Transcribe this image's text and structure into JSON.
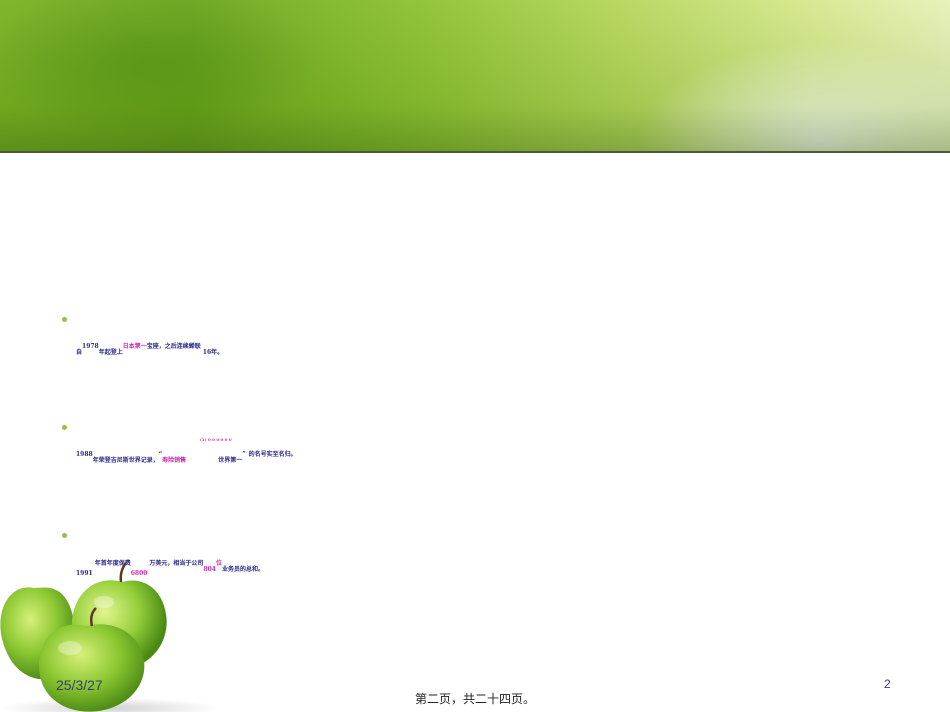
{
  "bullets": [
    {
      "parts": [
        "自",
        "1978",
        "年起登上",
        "日本第一",
        "宝座，之后连续蝉联",
        "16",
        "年。"
      ]
    },
    {
      "parts": [
        "1988",
        "年荣登吉尼斯世界记录，",
        "“",
        "寿险销售",
        "世界第一",
        "”",
        "的名号实至名归。"
      ],
      "tiny_note": "(1) 0 0 0 0 0 0"
    },
    {
      "parts": [
        "1991",
        "年首年度保费",
        "6800",
        "万美元，相当于公司",
        "804",
        "位",
        "业务员的总和。"
      ]
    }
  ],
  "footer": {
    "date": "25/3/27",
    "center_text": "第二页，共二十四页。",
    "page_number": "2"
  },
  "colors": {
    "banner_green": "#78b223",
    "text_navy": "#2a2a8c",
    "highlight_magenta": "#d12bb0",
    "bullet_green": "#8cc34a"
  }
}
